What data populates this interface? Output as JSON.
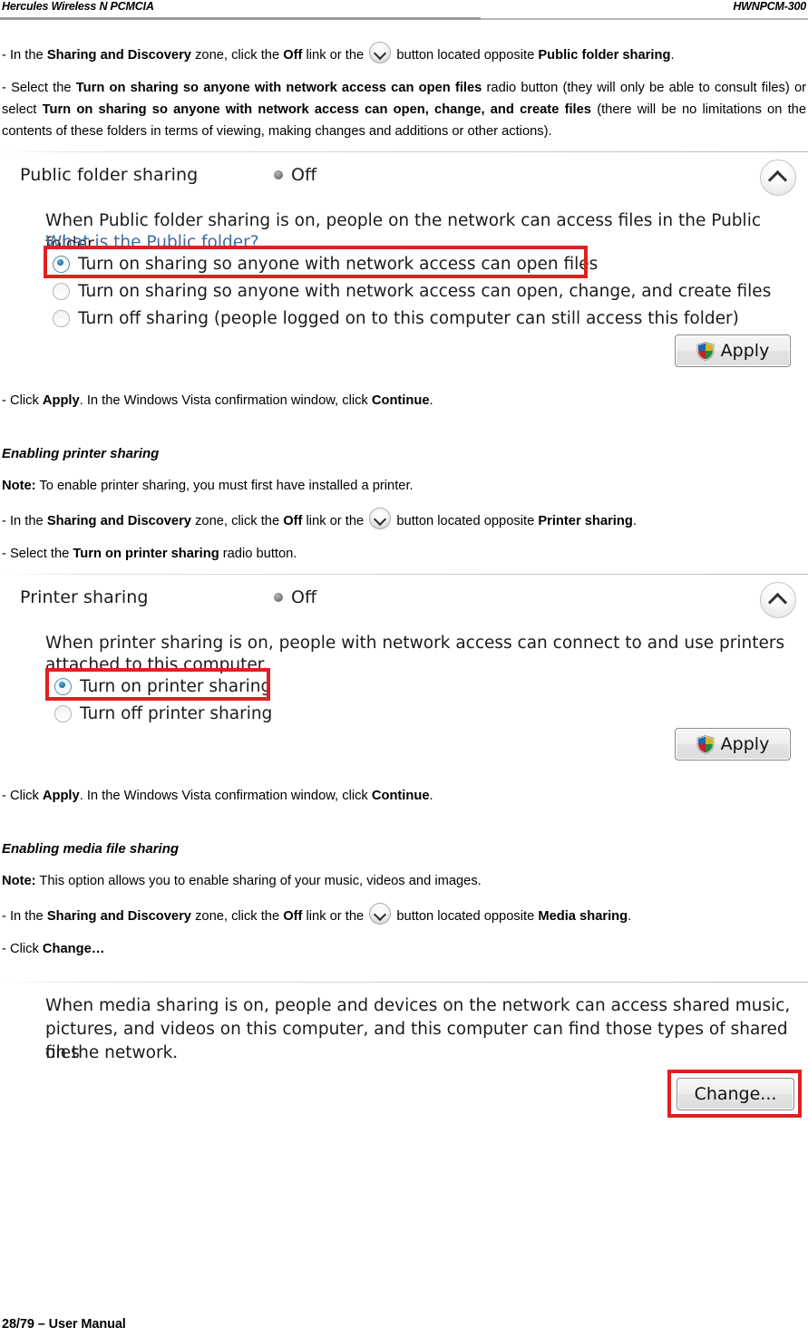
{
  "header": {
    "left": "Hercules Wireless N PCMCIA",
    "right": "HWNPCM-300"
  },
  "body": {
    "step_public_folder": {
      "p1": "- In the ",
      "b1": "Sharing and Discovery",
      "p2": " zone, click the ",
      "b2": "Off",
      "p3": " link or the ",
      "p4": " button located opposite ",
      "b3": "Public folder sharing",
      "p5": "."
    },
    "step_select_radio": {
      "p1": "- Select the ",
      "b1": "Turn on sharing so anyone with network access can open files",
      "p2": " radio button (they will only be able to consult files) or select ",
      "b2": "Turn on sharing so anyone with network access can open, change, and create files",
      "p3": " (there will be no limitations on the contents of these folders in terms of viewing, making changes and additions or other actions)."
    },
    "step_apply_1": {
      "p1": "- Click ",
      "b1": "Apply",
      "p2": ".  In the Windows Vista confirmation window, click ",
      "b2": "Continue",
      "p3": "."
    },
    "heading_printer": "Enabling printer sharing",
    "note_printer": {
      "b1": "Note:",
      "p1": " To enable printer sharing, you must first have installed a printer."
    },
    "step_printer_zone": {
      "p1": "- In the ",
      "b1": "Sharing and Discovery",
      "p2": " zone, click the ",
      "b2": "Off",
      "p3": " link or the ",
      "p4": " button located opposite ",
      "b3": "Printer sharing",
      "p5": "."
    },
    "step_printer_radio": {
      "p1": "- Select the ",
      "b1": "Turn on printer sharing",
      "p2": " radio button."
    },
    "step_apply_2": {
      "p1": "- Click ",
      "b1": "Apply",
      "p2": ".  In the Windows Vista confirmation window, click ",
      "b2": "Continue",
      "p3": "."
    },
    "heading_media": "Enabling media file sharing",
    "note_media": {
      "b1": "Note:",
      "p1": " This option allows you to enable sharing of your music, videos and images."
    },
    "step_media_zone": {
      "p1": "- In the ",
      "b1": "Sharing and Discovery",
      "p2": " zone, click the ",
      "b2": "Off",
      "p3": " link or the ",
      "p4": " button located opposite ",
      "b3": "Media sharing",
      "p5": "."
    },
    "step_media_change": {
      "p1": "- Click ",
      "b1": "Change…"
    }
  },
  "figure_public_folder": {
    "title": "Public folder sharing",
    "status": "Off",
    "collapse_icon": "chevron-up-icon",
    "description": "When Public folder sharing is on, people on the network can access files in the Public folder.",
    "link": "What is the Public folder?",
    "options": [
      {
        "label": "Turn on sharing so anyone with network access can open files",
        "selected": true,
        "highlighted": true
      },
      {
        "label": "Turn on sharing so anyone with network access can open, change, and create files",
        "selected": false,
        "highlighted": false
      },
      {
        "label": "Turn off sharing (people logged on to this computer can still access this folder)",
        "selected": false,
        "highlighted": false
      }
    ],
    "apply_label": "Apply",
    "apply_icon": "uac-shield-icon"
  },
  "figure_printer": {
    "title": "Printer sharing",
    "status": "Off",
    "collapse_icon": "chevron-up-icon",
    "description_line1": "When printer sharing is on, people with network access can connect to and use printers",
    "description_line2": "attached to this computer.",
    "options": [
      {
        "label": "Turn on printer sharing",
        "selected": true,
        "highlighted": true
      },
      {
        "label": "Turn off printer sharing",
        "selected": false,
        "highlighted": false
      }
    ],
    "apply_label": "Apply",
    "apply_icon": "uac-shield-icon"
  },
  "figure_media": {
    "description_line1": "When media sharing is on, people and devices on the network can access shared music,",
    "description_line2": "pictures, and videos on this computer, and this computer can find those types of shared files",
    "description_line3": "on the network.",
    "change_label": "Change...",
    "change_highlighted": true
  },
  "footer": {
    "text": "28/79 – User Manual"
  },
  "colors": {
    "annotation_red": "#e02020",
    "link_blue": "#3a6ea5",
    "radio_blue": "#11689e",
    "rule_gray": "#9a9a9a"
  }
}
